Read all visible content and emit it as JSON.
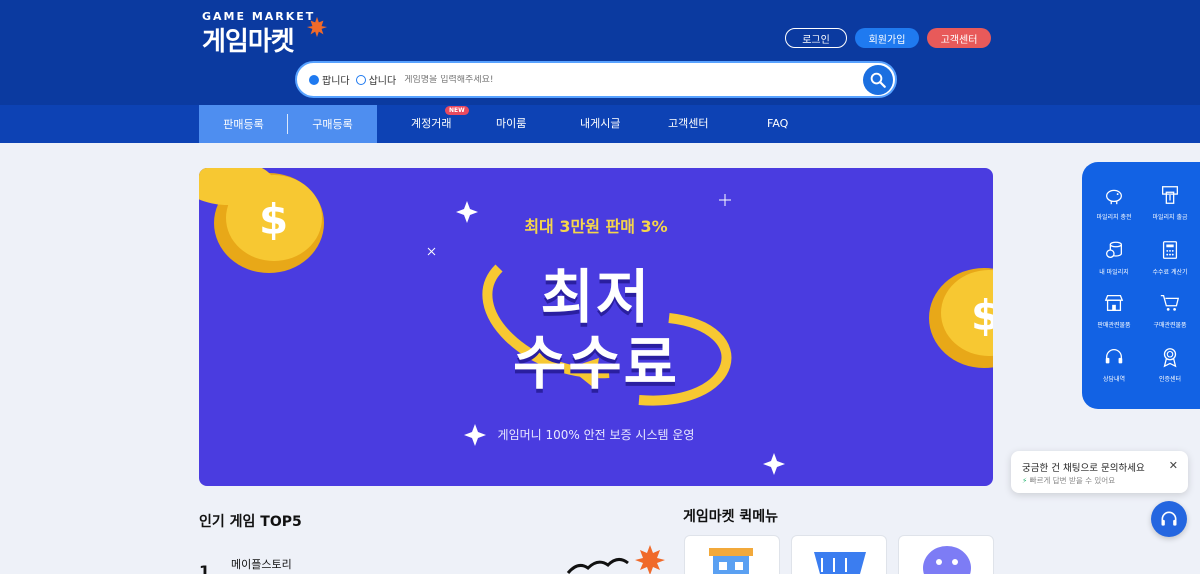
{
  "header": {
    "logo_small": "GAME MARKET",
    "logo_big": "게임마켓",
    "buttons": {
      "login": "로그인",
      "join": "회원가입",
      "cs": "고객센터"
    },
    "search": {
      "radio_sell": "팝니다",
      "radio_buy": "삽니다",
      "selected": "팝니다",
      "placeholder": "게임명을 입력해주세요!"
    }
  },
  "nav": {
    "left": [
      "판매등록",
      "구매등록"
    ],
    "items": [
      "계정거래",
      "마이룸",
      "내게시글",
      "고객센터",
      "FAQ"
    ],
    "new_badge": "NEW"
  },
  "banner": {
    "subtitle": "최대 3만원 판매 3%",
    "main_line1": "최저",
    "main_line2": "수수료",
    "caption": "게임머니 100% 안전 보증 시스템 운영"
  },
  "quick_panel": {
    "items": [
      {
        "label": "마일리지 충전",
        "icon": "piggy-bank-icon"
      },
      {
        "label": "마일리지 출금",
        "icon": "atm-icon"
      },
      {
        "label": "내 마일리지",
        "icon": "coins-icon"
      },
      {
        "label": "수수료 계산기",
        "icon": "calculator-icon"
      },
      {
        "label": "판매관련물품",
        "icon": "store-icon"
      },
      {
        "label": "구매관련물품",
        "icon": "cart-icon"
      },
      {
        "label": "상담내역",
        "icon": "headset-icon"
      },
      {
        "label": "인증센터",
        "icon": "badge-icon"
      }
    ]
  },
  "popular": {
    "title": "인기 게임 TOP5",
    "items": [
      {
        "rank": "1",
        "name": "메이플스토리"
      }
    ]
  },
  "quickmenu": {
    "title": "게임마켓 퀵메뉴"
  },
  "chat": {
    "title": "궁금한 건 채팅으로 문의하세요",
    "subtitle": "빠르게 답변 받을 수 있어요"
  },
  "colors": {
    "header_bg": "#0b3aa0",
    "nav_bg": "#0d42b4",
    "accent": "#1f7af0",
    "banner_bg": "#4a3ce0",
    "cs_button": "#e85a5a"
  }
}
